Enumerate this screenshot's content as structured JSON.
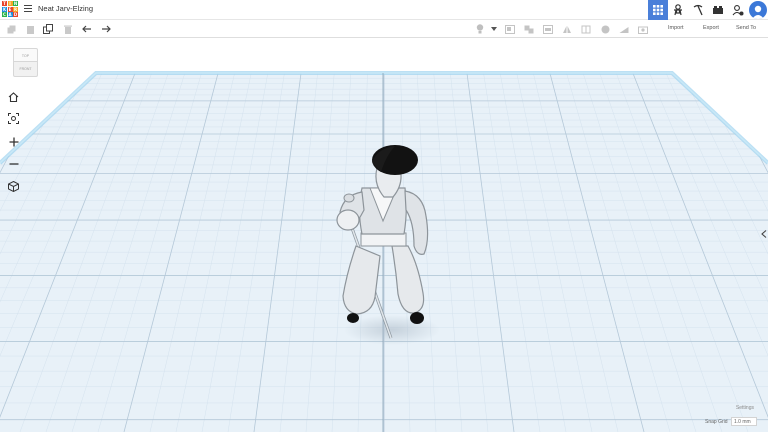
{
  "app": {
    "title": "Neat Jarv-Elzing",
    "logo_letters": [
      "T",
      "I",
      "N",
      "K",
      "E",
      "R",
      "C",
      "A",
      "D"
    ],
    "logo_colors": [
      "#e8462c",
      "#f5a623",
      "#2bb34b",
      "#1f8fdc",
      "#e8462c",
      "#f5a623",
      "#2bb34b",
      "#1f8fdc",
      "#e8462c"
    ]
  },
  "topbar": {
    "buttons": [
      {
        "name": "3d-design-view-button",
        "icon": "grid-icon",
        "active": true
      },
      {
        "name": "blocks-view-button",
        "icon": "gingerbread-icon",
        "active": false
      },
      {
        "name": "circuits-view-button",
        "icon": "pickaxe-icon",
        "active": false
      },
      {
        "name": "bricks-view-button",
        "icon": "bricks-icon",
        "active": false
      },
      {
        "name": "add-user-button",
        "icon": "add-user-icon",
        "active": false
      }
    ],
    "accent_color": "#4a7fd9"
  },
  "toolbar": {
    "import_label": "Import",
    "export_label": "Export",
    "send_to_label": "Send To"
  },
  "viewcube": {
    "top_label": "TOP",
    "front_label": "FRONT"
  },
  "workplane": {
    "settings_label": "Settings",
    "snap_grid_label": "Snap Grid",
    "snap_grid_value": "1.0 mm"
  }
}
